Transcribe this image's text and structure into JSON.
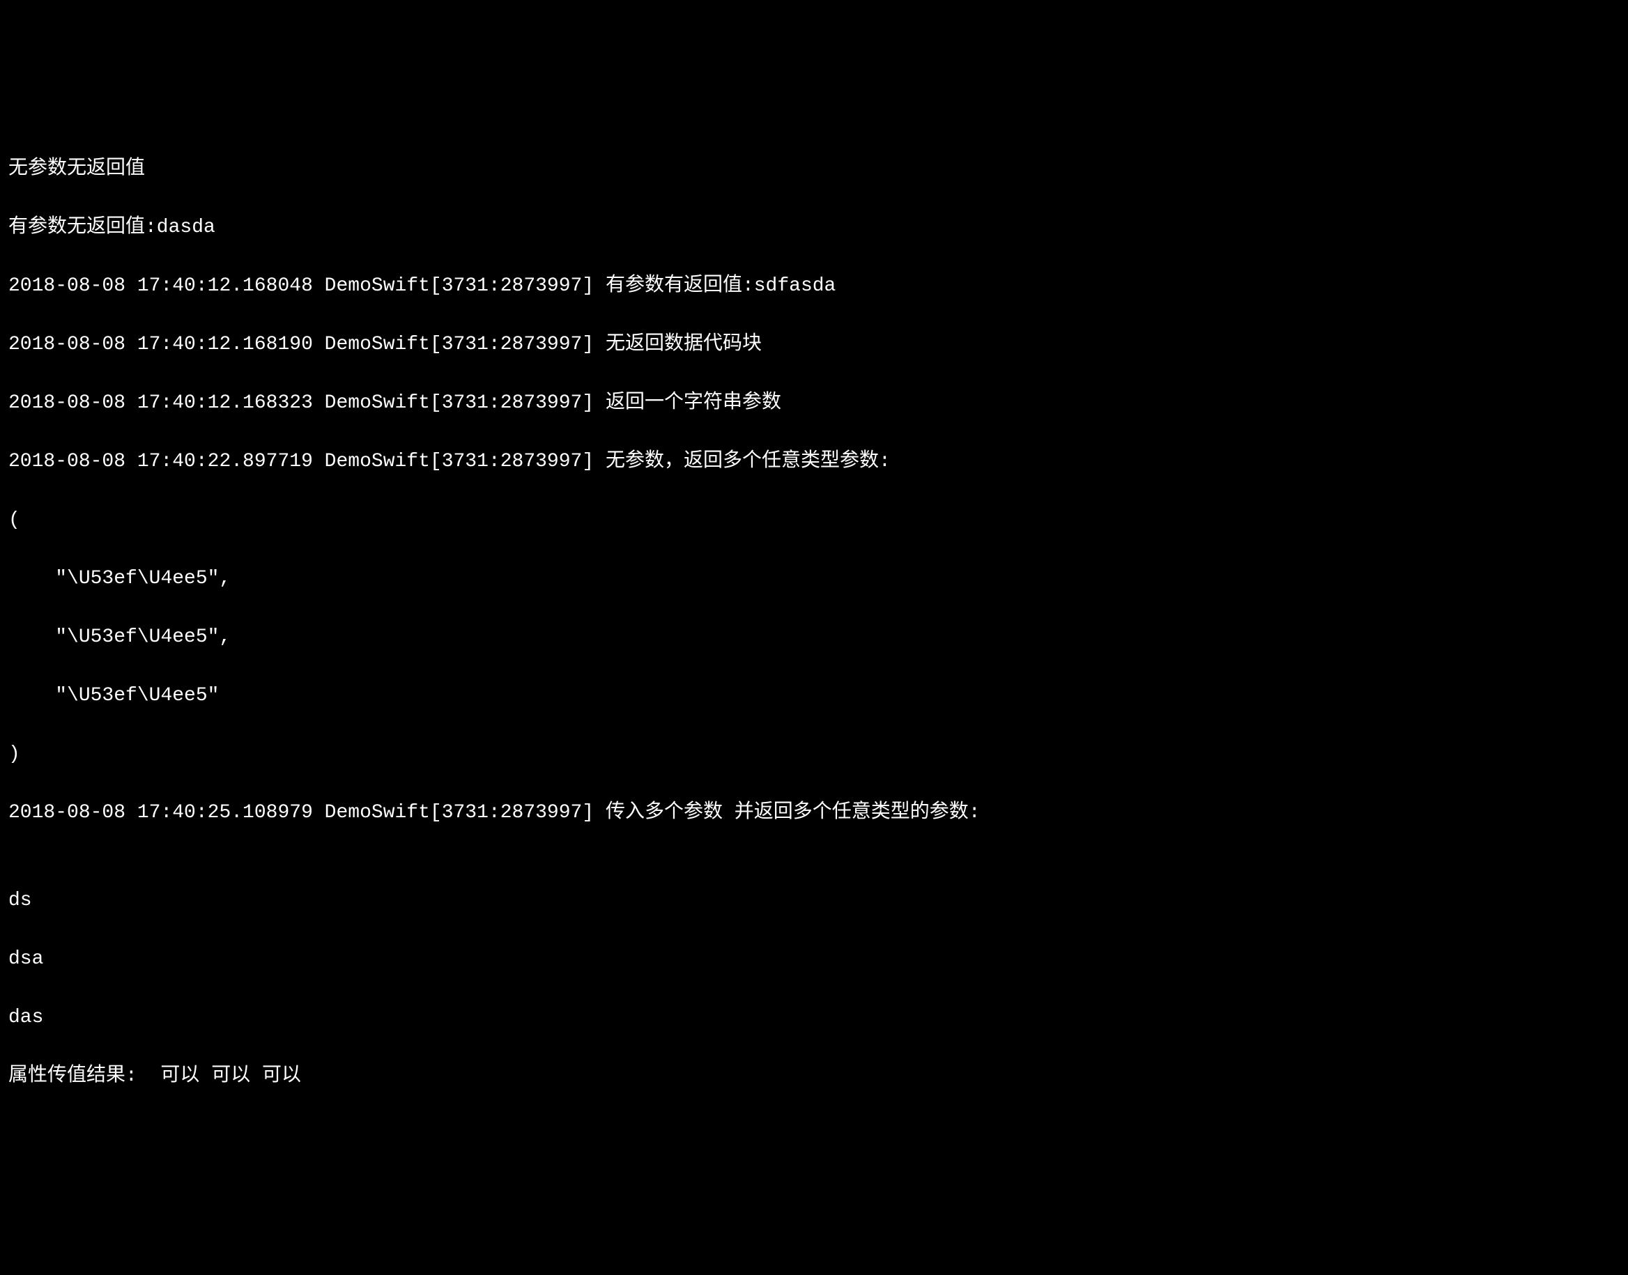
{
  "console": {
    "lines": [
      "无参数无返回值",
      "有参数无返回值:dasda",
      "2018-08-08 17:40:12.168048 DemoSwift[3731:2873997] 有参数有返回值:sdfasda",
      "2018-08-08 17:40:12.168190 DemoSwift[3731:2873997] 无返回数据代码块",
      "2018-08-08 17:40:12.168323 DemoSwift[3731:2873997] 返回一个字符串参数",
      "2018-08-08 17:40:22.897719 DemoSwift[3731:2873997] 无参数，返回多个任意类型参数:",
      "(",
      "    \"\\U53ef\\U4ee5\",",
      "    \"\\U53ef\\U4ee5\",",
      "    \"\\U53ef\\U4ee5\"",
      ")",
      "2018-08-08 17:40:25.108979 DemoSwift[3731:2873997] 传入多个参数 并返回多个任意类型的参数:",
      "",
      "ds",
      "dsa",
      "das",
      "属性传值结果:  可以 可以 可以"
    ]
  }
}
